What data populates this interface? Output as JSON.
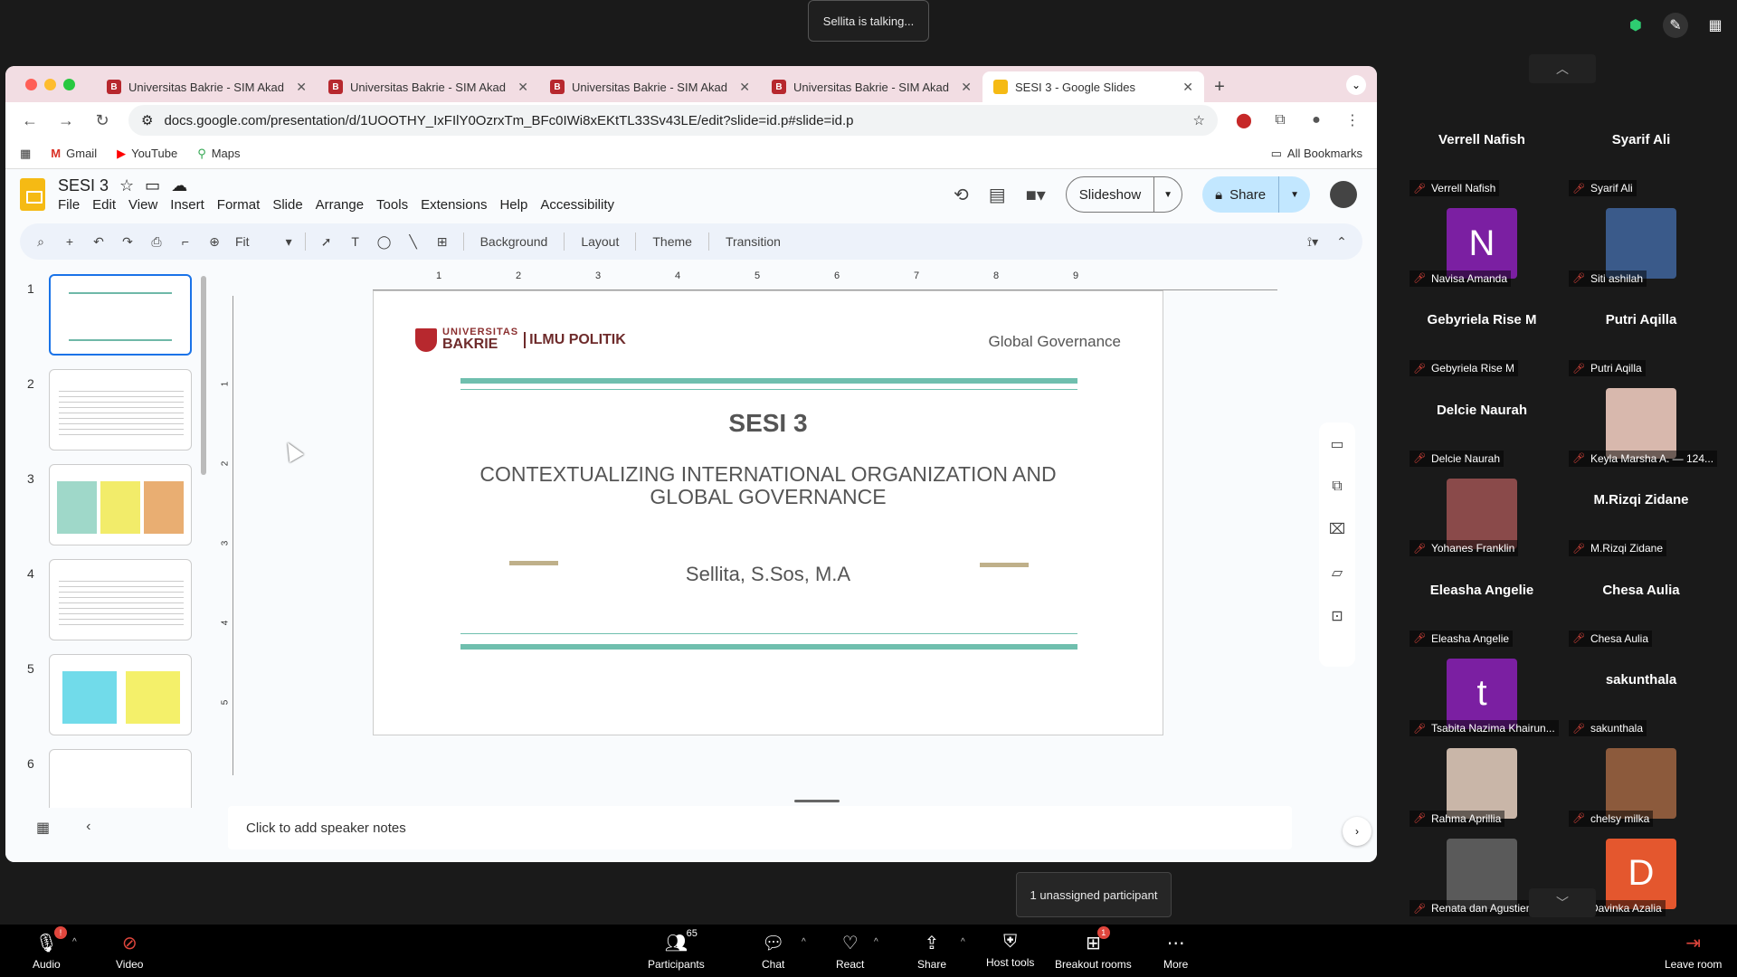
{
  "zoom": {
    "talking_toast": "Sellita is talking...",
    "unassigned_tooltip": "1 unassigned participant",
    "toolbar": {
      "audio": "Audio",
      "video": "Video",
      "participants": "Participants",
      "participants_count": "65",
      "chat": "Chat",
      "react": "React",
      "share": "Share",
      "host_tools": "Host tools",
      "breakout_rooms": "Breakout rooms",
      "breakout_badge": "1",
      "audio_badge": "!",
      "more": "More",
      "leave": "Leave room"
    },
    "gallery": [
      {
        "label": "Verrell Nafish",
        "big": "Verrell Nafish",
        "kind": "name"
      },
      {
        "label": "Syarif Ali",
        "big": "Syarif Ali",
        "kind": "name"
      },
      {
        "label": "Navisa Amanda",
        "big": "N",
        "kind": "letter",
        "color": "#7b1fa2"
      },
      {
        "label": "Siti ashilah",
        "big": "",
        "kind": "solid",
        "color": "#3a5a8a"
      },
      {
        "label": "Gebyriela Rise M",
        "big": "Gebyriela Rise M",
        "kind": "name"
      },
      {
        "label": "Putri Aqilla",
        "big": "Putri Aqilla",
        "kind": "name"
      },
      {
        "label": "Delcie Naurah",
        "big": "Delcie Naurah",
        "kind": "name"
      },
      {
        "label": "Keyla Marsha A. — 124...",
        "big": "",
        "kind": "photo",
        "color": "#d8b8ad"
      },
      {
        "label": "Yohanes Franklin",
        "big": "",
        "kind": "photo",
        "color": "#8a4a4a"
      },
      {
        "label": "M.Rizqi Zidane",
        "big": "M.Rizqi Zidane",
        "kind": "name"
      },
      {
        "label": "Eleasha Angelie",
        "big": "Eleasha Angelie",
        "kind": "name"
      },
      {
        "label": "Chesa Aulia",
        "big": "Chesa Aulia",
        "kind": "name"
      },
      {
        "label": "Tsabita Nazima Khairun...",
        "big": "t",
        "kind": "letter",
        "color": "#7b1fa2"
      },
      {
        "label": "sakunthala",
        "big": "sakunthala",
        "kind": "name"
      },
      {
        "label": "Rahma Aprillia",
        "big": "",
        "kind": "photo",
        "color": "#c9b6a8"
      },
      {
        "label": "chelsy milka",
        "big": "",
        "kind": "photo",
        "color": "#8c5a3c"
      },
      {
        "label": "Renata dan Agustien",
        "big": "",
        "kind": "photo",
        "color": "#5a5a5a"
      },
      {
        "label": "Davinka Azalia",
        "big": "D",
        "kind": "letter",
        "color": "#e4572e"
      }
    ]
  },
  "browser": {
    "tabs": [
      {
        "title": "Universitas Bakrie - SIM Akad"
      },
      {
        "title": "Universitas Bakrie - SIM Akad"
      },
      {
        "title": "Universitas Bakrie - SIM Akad"
      },
      {
        "title": "Universitas Bakrie - SIM Akad"
      },
      {
        "title": "SESI 3 - Google Slides"
      }
    ],
    "url": "docs.google.com/presentation/d/1UOOTHY_IxFIlY0OzrxTm_BFc0IWi8xEKtTL33Sv43LE/edit?slide=id.p#slide=id.p",
    "bookmarks": [
      "Gmail",
      "YouTube",
      "Maps"
    ],
    "all_bookmarks": "All Bookmarks"
  },
  "slides": {
    "doc_title": "SESI 3",
    "menu": [
      "File",
      "Edit",
      "View",
      "Insert",
      "Format",
      "Slide",
      "Arrange",
      "Tools",
      "Extensions",
      "Help",
      "Accessibility"
    ],
    "slideshow": "Slideshow",
    "share": "Share",
    "zoom": "Fit",
    "toolbar_text": [
      "Background",
      "Layout",
      "Theme",
      "Transition"
    ],
    "thumb_numbers": [
      "1",
      "2",
      "3",
      "4",
      "5",
      "6"
    ],
    "ruler_h": [
      "1",
      "2",
      "3",
      "4",
      "5",
      "6",
      "7",
      "8",
      "9"
    ],
    "ruler_v": [
      "1",
      "2",
      "3",
      "4",
      "5"
    ],
    "speaker_notes": "Click to add speaker notes",
    "slide": {
      "logo_top": "UNIVERSITAS",
      "logo_main": "BAKRIE",
      "logo_right": "ILMU POLITIK",
      "brand": "Global Governance",
      "heading": "SESI 3",
      "subtitle": "CONTEXTUALIZING INTERNATIONAL ORGANIZATION AND GLOBAL GOVERNANCE",
      "author": "Sellita, S.Sos, M.A"
    }
  }
}
